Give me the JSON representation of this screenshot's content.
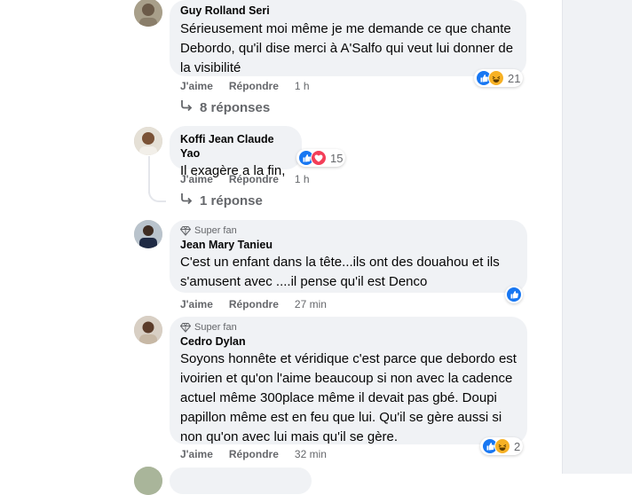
{
  "comments": [
    {
      "author": "Guy Rolland Seri",
      "text_lines": [
        "Sérieusement moi même je me demande ce que chante",
        "Debordo, qu'il dise merci à A'Salfo qui veut lui donner de",
        "la visibilité"
      ],
      "like_label": "J'aime",
      "reply_label": "Répondre",
      "time": "1 h",
      "reaction_count": "21",
      "reaction_icons": [
        "like-icon",
        "haha-icon"
      ],
      "replies_label": "8 réponses"
    },
    {
      "author": "Koffi Jean Claude Yao",
      "text_lines": [
        "Il exagère a la fin,"
      ],
      "like_label": "J'aime",
      "reply_label": "Répondre",
      "time": "1 h",
      "reaction_count": "15",
      "reaction_icons": [
        "like-icon",
        "love-icon"
      ],
      "replies_label": "1 réponse"
    },
    {
      "badge": "Super fan",
      "author": "Jean Mary Tanieu",
      "text_lines": [
        "C'est un enfant dans la tête...ils ont des douahou et ils",
        "s'amusent avec ....il pense qu'il est Denco"
      ],
      "like_label": "J'aime",
      "reply_label": "Répondre",
      "time": "27 min",
      "reaction_icons": [
        "like-icon"
      ]
    },
    {
      "badge": "Super fan",
      "author": "Cedro Dylan",
      "text_lines": [
        "Soyons honnête et véridique c'est parce que debordo est",
        "ivoirien et qu'on l'aime beaucoup si non avec la cadence",
        "actuel même 300place même il devait pas gbé. Doupi",
        "papillon même est en feu que lui. Qu'il se gère aussi si",
        "non qu'on avec lui mais qu'il se gère."
      ],
      "like_label": "J'aime",
      "reply_label": "Répondre",
      "time": "32 min",
      "reaction_count": "2",
      "reaction_icons": [
        "like-icon",
        "haha-icon"
      ]
    }
  ],
  "colors": {
    "bubble": "#f0f2f5",
    "secondary_text": "#65676b",
    "like_blue": "#1877f2",
    "haha_yellow": "#f7b125",
    "love_red": "#f33e58"
  }
}
